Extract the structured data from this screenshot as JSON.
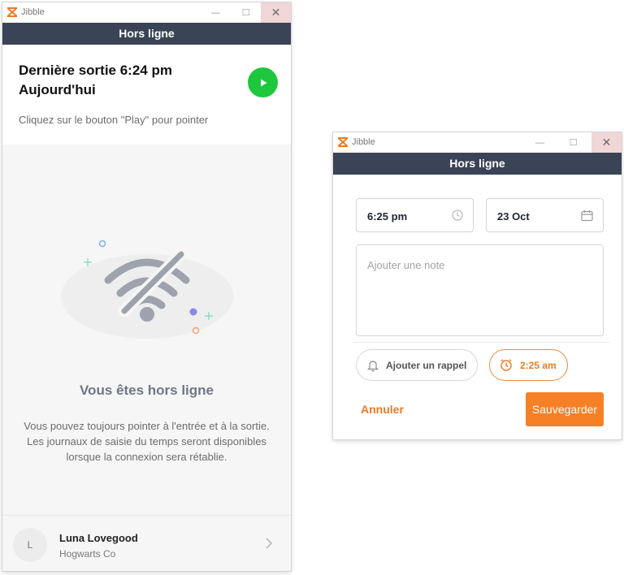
{
  "app": {
    "name": "Jibble",
    "brand_color": "#f07a22"
  },
  "colors": {
    "header": "#3b4456",
    "play": "#1ec83c",
    "accent": "#f68026"
  },
  "window_controls": {
    "minimize": "—",
    "maximize": "☐",
    "close": "✕"
  },
  "offline_window": {
    "header": "Hors ligne",
    "last_punch_line1": "Dernière sortie 6:24 pm",
    "last_punch_line2": "Aujourd'hui",
    "hint": "Cliquez sur le bouton \"Play\" pour pointer",
    "illustration_icon": "wifi-off-icon",
    "offline_title": "Vous êtes hors ligne",
    "offline_message_lines": [
      "Vous pouvez toujours pointer à l'entrée et à la sortie.",
      "Les journaux de saisie du temps seront disponibles",
      "lorsque la connexion sera rétablie."
    ],
    "user": {
      "initial": "L",
      "name": "Luna Lovegood",
      "organization": "Hogwarts Co"
    }
  },
  "entry_window": {
    "header": "Hors ligne",
    "time_value": "6:25 pm",
    "date_value": "23 Oct",
    "note_placeholder": "Ajouter une note",
    "reminder_label": "Ajouter un rappel",
    "reminder_time": "2:25 am",
    "cancel_label": "Annuler",
    "save_label": "Sauvegarder"
  }
}
